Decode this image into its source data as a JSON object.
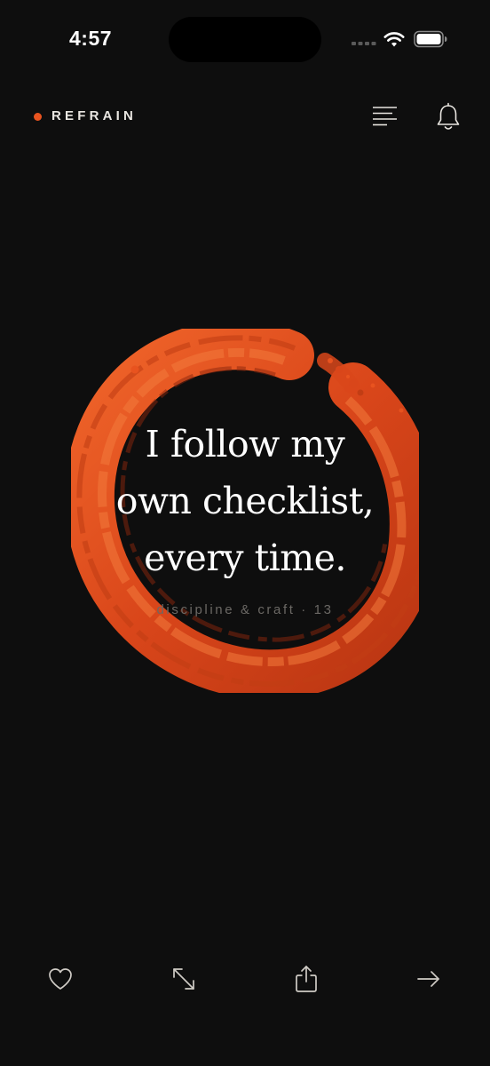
{
  "status_bar": {
    "time": "4:57",
    "icons": [
      "signal-icon",
      "wifi-icon",
      "battery-icon"
    ]
  },
  "header": {
    "brand": "REFRAIN",
    "brand_dot_color": "#e8531f",
    "menu_icon": "menu-lines-icon",
    "notification_icon": "bell-icon"
  },
  "affirmation": {
    "text": "I follow my\nown checklist,\nevery time.",
    "meta": "discipline & craft · 13",
    "art_icon": "enso-brush-circle",
    "art_color": "#e0521c"
  },
  "toolbar": {
    "items": [
      {
        "icon": "heart-icon",
        "action": "like"
      },
      {
        "icon": "expand-icon",
        "action": "expand"
      },
      {
        "icon": "share-icon",
        "action": "share"
      },
      {
        "icon": "arrow-right-icon",
        "action": "next"
      }
    ]
  },
  "colors": {
    "background": "#0e0e0e",
    "accent": "#e8531f",
    "text": "#ffffff",
    "muted": "#6b6864"
  }
}
